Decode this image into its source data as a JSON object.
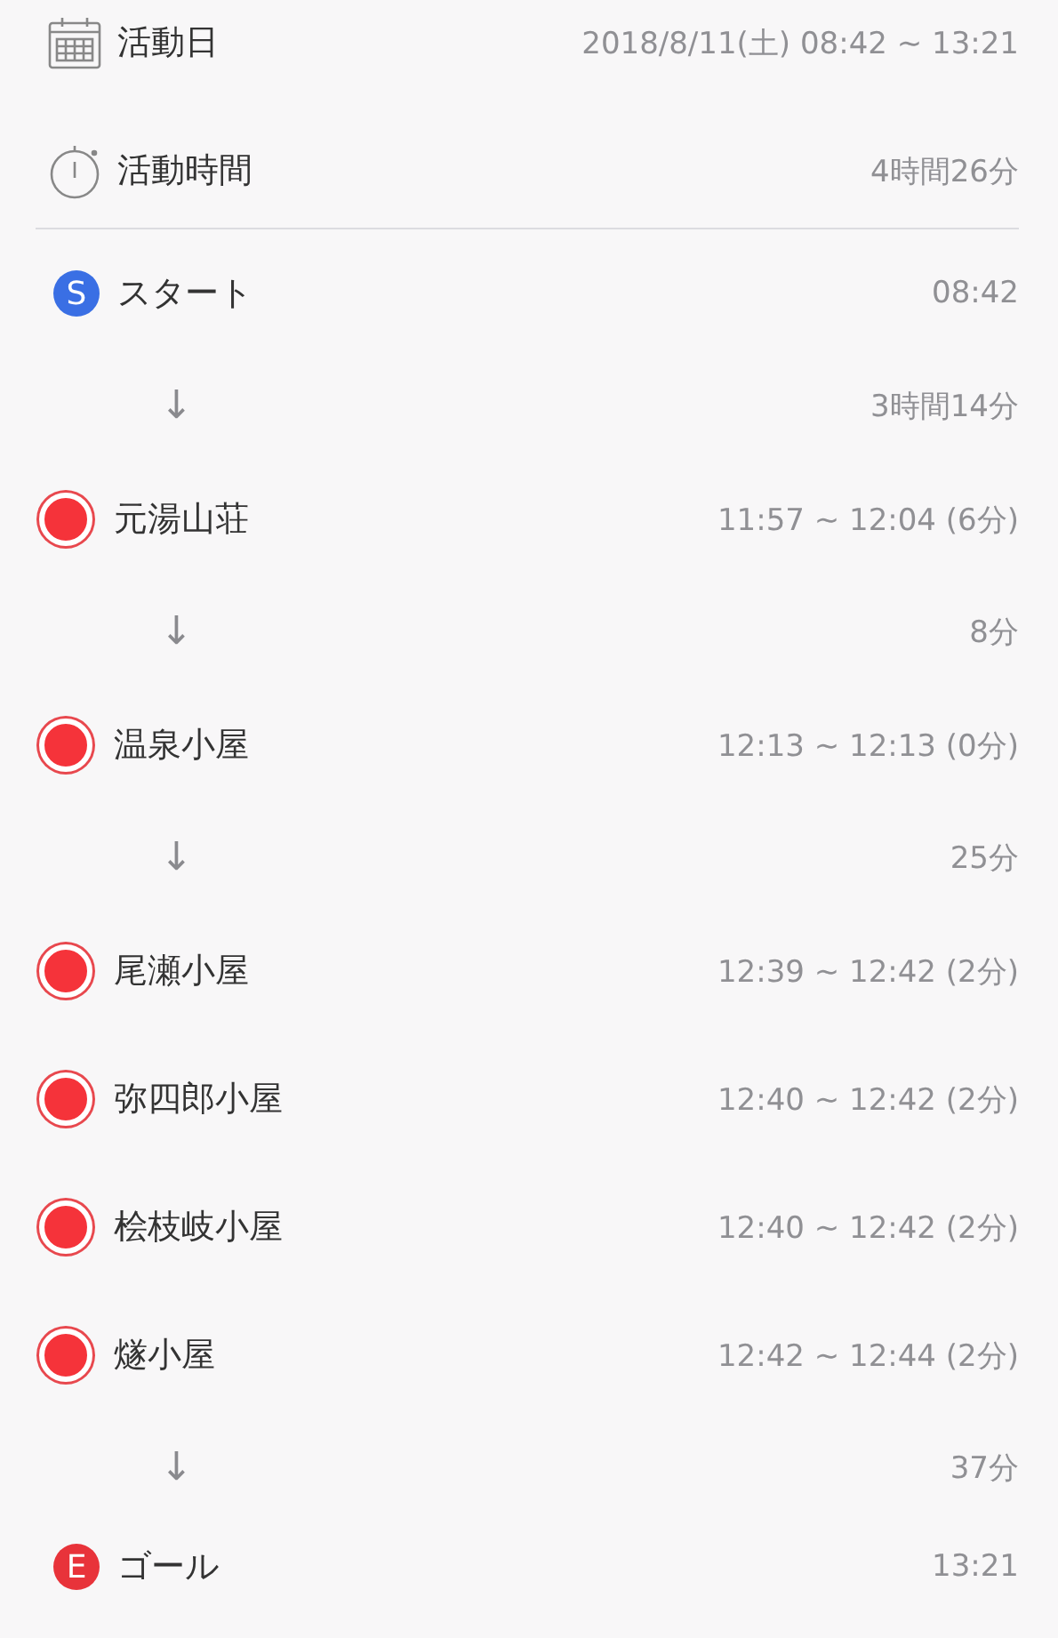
{
  "summary": [
    {
      "kind": "date",
      "label": "活動日",
      "value": "2018/8/11(土) 08:42 ~ 13:21"
    },
    {
      "kind": "duration",
      "label": "活動時間",
      "value": "4時間26分"
    }
  ],
  "timeline": [
    {
      "kind": "start",
      "badge": "S",
      "label": "スタート",
      "time": "08:42"
    },
    {
      "kind": "leg",
      "arrow": "↓",
      "duration": "3時間14分"
    },
    {
      "kind": "point",
      "label": "元湯山荘",
      "time": "11:57 ~ 12:04 (6分)"
    },
    {
      "kind": "leg",
      "arrow": "↓",
      "duration": "8分"
    },
    {
      "kind": "point",
      "label": "温泉小屋",
      "time": "12:13 ~ 12:13 (0分)"
    },
    {
      "kind": "leg",
      "arrow": "↓",
      "duration": "25分"
    },
    {
      "kind": "point",
      "label": "尾瀬小屋",
      "time": "12:39 ~ 12:42 (2分)"
    },
    {
      "kind": "point",
      "label": "弥四郎小屋",
      "time": "12:40 ~ 12:42 (2分)"
    },
    {
      "kind": "point",
      "label": "桧枝岐小屋",
      "time": "12:40 ~ 12:42 (2分)"
    },
    {
      "kind": "point",
      "label": "燧小屋",
      "time": "12:42 ~ 12:44 (2分)"
    },
    {
      "kind": "leg",
      "arrow": "↓",
      "duration": "37分"
    },
    {
      "kind": "goal",
      "badge": "E",
      "label": "ゴール",
      "time": "13:21"
    }
  ]
}
